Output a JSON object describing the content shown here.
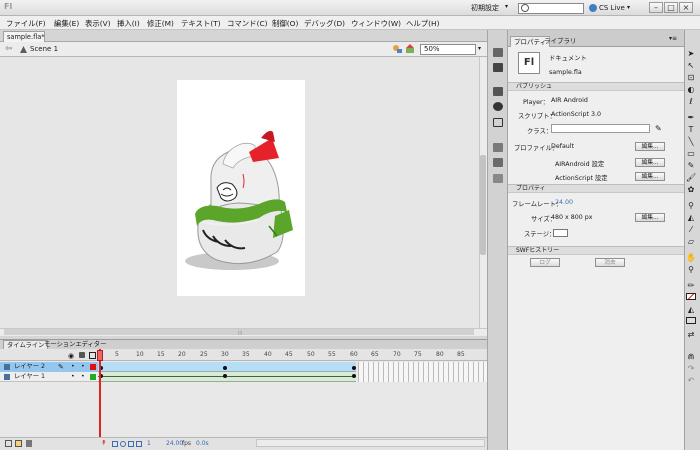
{
  "titlebar": {
    "app_logo": "Fl",
    "workspace": "初期設定",
    "search_value": "",
    "cs_live": "CS Live"
  },
  "menu": [
    "ファイル(F)",
    "編集(E)",
    "表示(V)",
    "挿入(I)",
    "修正(M)",
    "テキスト(T)",
    "コマンド(C)",
    "制御(O)",
    "デバッグ(D)",
    "ウィンドウ(W)",
    "ヘルプ(H)"
  ],
  "document": {
    "tab_label": "sample.fla*",
    "scene_label": "Scene 1",
    "zoom": "50%"
  },
  "timeline": {
    "tabs": [
      "タイムライン",
      "モーションエディター"
    ],
    "frame_ticks": [
      "5",
      "10",
      "15",
      "20",
      "25",
      "30",
      "35",
      "40",
      "45",
      "50",
      "55",
      "60",
      "65",
      "70",
      "75",
      "80",
      "85"
    ],
    "layers": [
      {
        "name": "レイヤー 2",
        "selected": true
      },
      {
        "name": "レイヤー 1",
        "selected": false
      }
    ],
    "current_frame": "1",
    "fps": "24.00",
    "fps_unit": "fps",
    "time": "0.0s"
  },
  "properties": {
    "tabs": [
      "プロパティ",
      "ライブラリ"
    ],
    "doc_type": "ドキュメント",
    "doc_icon": "Fl",
    "file_name": "sample.fla",
    "publish_section": "パブリッシュ",
    "player_label": "Player：",
    "player_value": "AIR Android",
    "script_label": "スクリプト：",
    "script_value": "ActionScript 3.0",
    "class_label": "クラス：",
    "class_value": "",
    "profile_label": "プロファイル：",
    "profile_value": "Default",
    "edit_button": "編集...",
    "air_settings": "AIRAndroid 設定",
    "as_settings": "ActionScript 設定",
    "properties_section": "プロパティ",
    "fps_label": "フレームレート：",
    "fps_value": "24.00",
    "size_label": "サイズ：",
    "size_value": "480 x 800 px",
    "stage_label": "ステージ：",
    "swf_section": "SWFヒストリー",
    "log_button": "ログ",
    "clear_button": "消去"
  },
  "colors": {
    "playhead": "#e22222",
    "selected_layer": "#94c7ee",
    "link_blue": "#3a6cb0",
    "daruma_red": "#e5222b",
    "daruma_green": "#5aa52a"
  }
}
